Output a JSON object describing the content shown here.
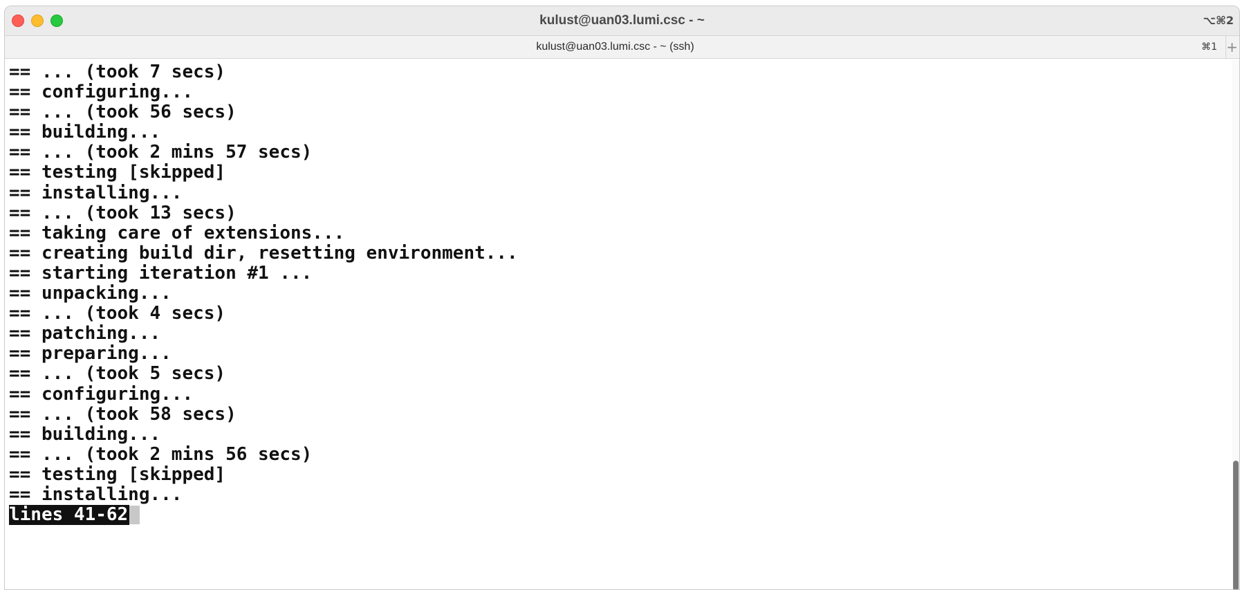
{
  "window": {
    "title": "kulust@uan03.lumi.csc - ~",
    "shortcut": "⌥⌘2"
  },
  "tab": {
    "title": "kulust@uan03.lumi.csc - ~ (ssh)",
    "shortcut": "⌘1",
    "new_tab_glyph": "+"
  },
  "terminal": {
    "lines": [
      "== ... (took 7 secs)",
      "== configuring...",
      "== ... (took 56 secs)",
      "== building...",
      "== ... (took 2 mins 57 secs)",
      "== testing [skipped]",
      "== installing...",
      "== ... (took 13 secs)",
      "== taking care of extensions...",
      "== creating build dir, resetting environment...",
      "== starting iteration #1 ...",
      "== unpacking...",
      "== ... (took 4 secs)",
      "== patching...",
      "== preparing...",
      "== ... (took 5 secs)",
      "== configuring...",
      "== ... (took 58 secs)",
      "== building...",
      "== ... (took 2 mins 56 secs)",
      "== testing [skipped]",
      "== installing..."
    ],
    "status": "lines 41-62"
  },
  "colors": {
    "close": "#fe5f57",
    "minimize": "#febc2e",
    "zoom": "#28c840",
    "text": "#111111"
  }
}
